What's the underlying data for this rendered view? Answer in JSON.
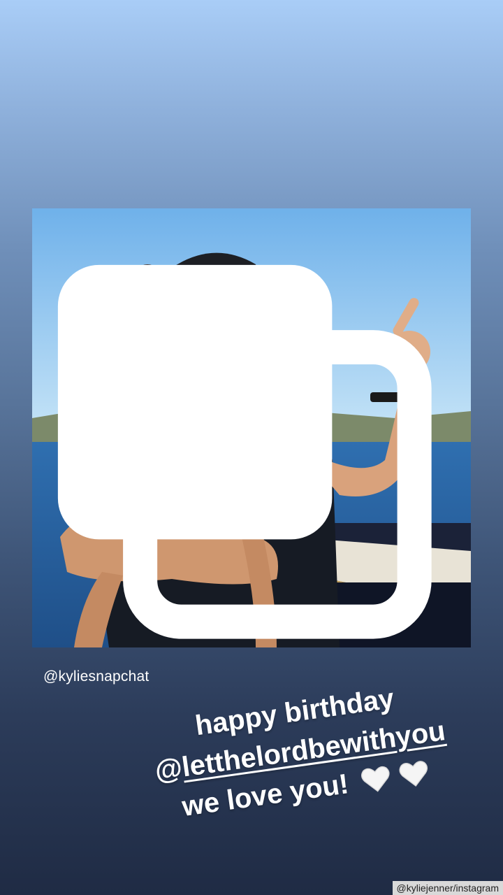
{
  "story": {
    "post_image_alt": "Man in cap and sunglasses holding a toddler on a boat, both pointing at the sky",
    "multi_photo_icon": "carousel-icon",
    "handle_tag": "@kyliesnapchat",
    "caption": {
      "line1": "happy birthday",
      "mention_at": "@",
      "mention_name": "letthelordbewithyou",
      "line3": "we love you!",
      "emoji": [
        "white-heart-icon",
        "white-heart-icon"
      ]
    }
  },
  "watermark": "@kyliejenner/instagram"
}
